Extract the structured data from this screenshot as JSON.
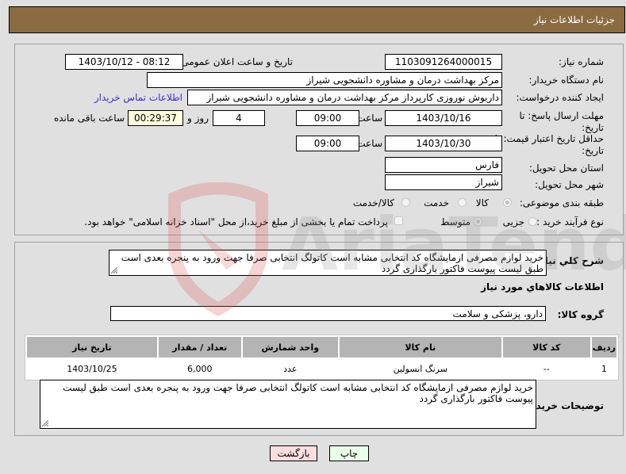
{
  "header": {
    "title": "جزئیات اطلاعات نیاز"
  },
  "form": {
    "need_number": {
      "label": "شماره نیاز:",
      "value": "1103091264000015"
    },
    "announce_datetime": {
      "label": "تاریخ و ساعت اعلان عمومی:",
      "value": "1403/10/12 - 08:12"
    },
    "buyer_org": {
      "label": "نام دستگاه خریدار:",
      "value": "مرکز بهداشت  درمان و مشاوره دانشجویی شیراز"
    },
    "requester": {
      "label": "ایجاد کننده درخواست:",
      "value": "داریوش  نوروزی کارپرداز مرکز بهداشت  درمان و مشاوره دانشجویی شیراز"
    },
    "buyer_contact_link": "اطلاعات تماس خریدار",
    "reply_deadline": {
      "label_line1": "مهلت ارسال پاسخ: تا",
      "label_line2": "تاریخ:",
      "date": "1403/10/16",
      "time_label": "ساعت",
      "time": "09:00",
      "days": "4",
      "days_label": "روز و",
      "remaining": "00:29:37",
      "remaining_label": "ساعت باقی مانده"
    },
    "price_validity": {
      "label_line1": "حداقل تاریخ اعتبار قیمت: تا",
      "label_line2": "تاریخ:",
      "date": "1403/10/30",
      "time_label": "ساعت",
      "time": "09:00"
    },
    "province": {
      "label": "استان محل تحویل:",
      "value": "فارس"
    },
    "city": {
      "label": "شهر محل تحویل:",
      "value": "شیراز"
    },
    "category": {
      "label": "طبقه بندی موضوعی:",
      "options": [
        {
          "label": "کالا",
          "checked": true
        },
        {
          "label": "خدمت",
          "checked": false
        },
        {
          "label": "کالا/خدمت",
          "checked": false
        }
      ]
    },
    "purchase_type": {
      "label": "نوع فرآیند خرید :",
      "options": [
        {
          "label": "جزیی",
          "checked": false
        },
        {
          "label": "متوسط",
          "checked": true
        }
      ],
      "payment_note": "پرداخت تمام یا بخشی از مبلغ خرید،از محل \"اسناد خزانه اسلامی\" خواهد بود."
    }
  },
  "summary": {
    "label": "شرح کلي نياز:",
    "value": "خرید لوازم مصرفی ازمایشگاه کد انتخابی مشابه است کاتولگ انتخابی صرفا جهت ورود به پنجره بعدی است طبق لیست پیوست  فاکتور  بارگذاری گردد"
  },
  "goods": {
    "section_title": "اطلاعات کالاهاي مورد نياز",
    "group_label": "گروه کالا:",
    "group_value": "دارو، پزشکی و سلامت",
    "columns": [
      "ردیف",
      "کد کالا",
      "نام کالا",
      "واحد شمارش",
      "تعداد / مقدار",
      "تاریخ نیاز"
    ],
    "rows": [
      {
        "row": "1",
        "code": "--",
        "name": "سرنگ انسولین",
        "unit": "عدد",
        "qty": "6,000",
        "date": "1403/10/25"
      }
    ]
  },
  "buyer_notes": {
    "label": "توضیحات خریدار:",
    "value": "خرید لوازم مصرفی ازمایشگاه کد انتخابی مشابه است کاتولگ انتخابی صرفا جهت ورود به پنجره بعدی است طبق لیست پیوست  فاکتور  بارگذاری گردد"
  },
  "buttons": {
    "print": "چاپ",
    "back": "بازگشت"
  },
  "watermark": {
    "text": "AriaTender.net",
    "color": "#d9534f"
  }
}
